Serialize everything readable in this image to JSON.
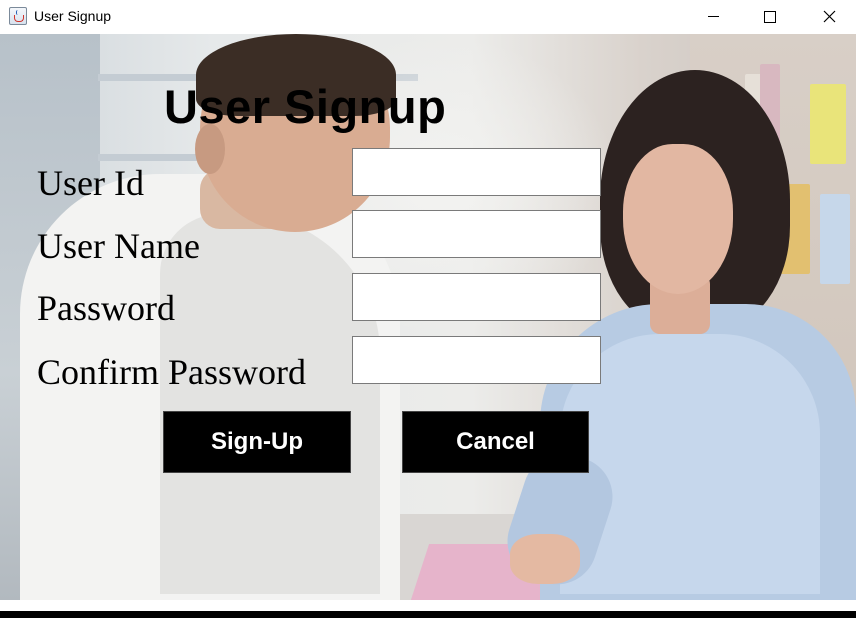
{
  "window": {
    "title": "User Signup",
    "icon": "java-cup-icon",
    "controls": {
      "minimize": "minimize-icon",
      "maximize": "maximize-icon",
      "close": "close-icon"
    }
  },
  "form": {
    "title": "User Signup",
    "fields": [
      {
        "label": "User Id",
        "value": "",
        "placeholder": ""
      },
      {
        "label": "User Name",
        "value": "",
        "placeholder": ""
      },
      {
        "label": "Password",
        "value": "",
        "placeholder": ""
      },
      {
        "label": "Confirm Password",
        "value": "",
        "placeholder": ""
      }
    ],
    "buttons": {
      "signup": "Sign-Up",
      "cancel": "Cancel"
    }
  },
  "colors": {
    "button_background": "#000000",
    "button_text": "#ffffff",
    "title_text": "#000000"
  }
}
